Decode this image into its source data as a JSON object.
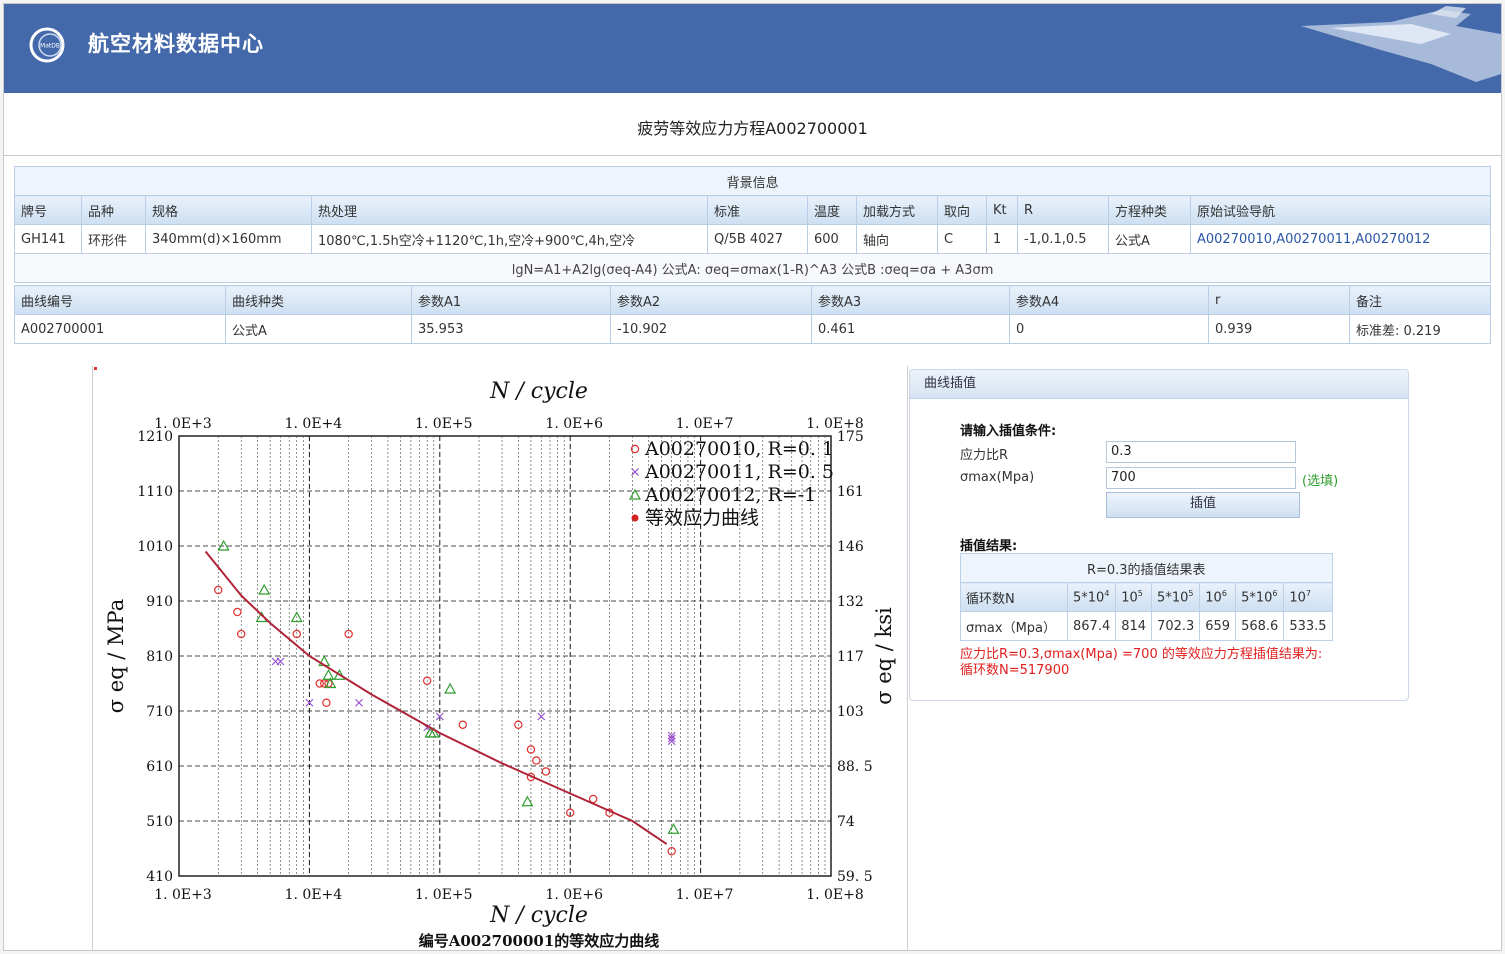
{
  "header": {
    "app_title": "航空材料数据中心",
    "logo_text": "MatDB"
  },
  "page_title": "疲劳等效应力方程A002700001",
  "background": {
    "caption": "背景信息",
    "headers": [
      "牌号",
      "品种",
      "规格",
      "热处理",
      "标准",
      "温度",
      "加载方式",
      "取向",
      "Kt",
      "R",
      "方程种类",
      "原始试验导航"
    ],
    "row": [
      "GH141",
      "环形件",
      "340mm(d)×160mm",
      "1080℃,1.5h空冷+1120℃,1h,空冷+900℃,4h,空冷",
      "Q/5B 4027",
      "600",
      "轴向",
      "C",
      "1",
      "-1,0.1,0.5",
      "公式A",
      "A00270010,A00270011,A00270012"
    ]
  },
  "formula": "lgN=A1+A2lg(σeq-A4) 公式A:  σeq=σmax(1-R)^A3 公式B :σeq=σa + A3σm",
  "curve": {
    "headers": [
      "曲线编号",
      "曲线种类",
      "参数A1",
      "参数A2",
      "参数A3",
      "参数A4",
      "r",
      "备注"
    ],
    "row": [
      "A002700001",
      "公式A",
      "35.953",
      "-10.902",
      "0.461",
      "0",
      "0.939",
      "标准差: 0.219"
    ]
  },
  "chart_data": {
    "type": "scatter",
    "title": "N / cycle",
    "xlabel": "N / cycle",
    "ylabel": "σ eq / MPa",
    "ylabel_right": "σ eq / ksi",
    "caption": "编号A002700001的等效应力曲线",
    "xscale": "log",
    "xlim": [
      1000,
      100000000
    ],
    "ylim": [
      410,
      1210
    ],
    "x_ticks": [
      "1. 0E+3",
      "1. 0E+4",
      "1. 0E+5",
      "1. 0E+6",
      "1. 0E+7",
      "1. 0E+8"
    ],
    "y_ticks": [
      "1210",
      "1110",
      "1010",
      "910",
      "810",
      "710",
      "610",
      "510",
      "410"
    ],
    "y_ticks_right": [
      "175",
      "161",
      "146",
      "132",
      "117",
      "103",
      "88. 5",
      "74",
      "59. 5"
    ],
    "grid": true,
    "legend_position": "top-right",
    "series": [
      {
        "name": "A00270010, R=0. 1",
        "marker": "circle",
        "color": "#e03030",
        "points": [
          [
            2000,
            930
          ],
          [
            2800,
            890
          ],
          [
            3000,
            850
          ],
          [
            8000,
            850
          ],
          [
            20000,
            850
          ],
          [
            12000,
            760
          ],
          [
            13000,
            760
          ],
          [
            14000,
            760
          ],
          [
            13500,
            725
          ],
          [
            80000,
            765
          ],
          [
            150000,
            685
          ],
          [
            400000,
            685
          ],
          [
            500000,
            640
          ],
          [
            550000,
            620
          ],
          [
            650000,
            600
          ],
          [
            500000,
            590
          ],
          [
            1000000,
            525
          ],
          [
            1500000,
            550
          ],
          [
            2000000,
            525
          ],
          [
            6000000,
            455
          ]
        ]
      },
      {
        "name": "A00270011, R=0. 5",
        "marker": "x",
        "color": "#9b4fd0",
        "points": [
          [
            5500,
            800
          ],
          [
            6000,
            800
          ],
          [
            10000,
            725
          ],
          [
            24000,
            725
          ],
          [
            80000,
            680
          ],
          [
            100000,
            700
          ],
          [
            600000,
            700
          ],
          [
            6000000,
            665
          ],
          [
            6000000,
            660
          ],
          [
            6000000,
            655
          ]
        ]
      },
      {
        "name": "A00270012, R=-1",
        "marker": "triangle",
        "color": "#2f9e2f",
        "points": [
          [
            2200,
            1010
          ],
          [
            4500,
            930
          ],
          [
            4300,
            880
          ],
          [
            8000,
            880
          ],
          [
            13000,
            800
          ],
          [
            14000,
            775
          ],
          [
            14500,
            760
          ],
          [
            17000,
            775
          ],
          [
            85000,
            670
          ],
          [
            90000,
            670
          ],
          [
            120000,
            750
          ],
          [
            470000,
            545
          ],
          [
            6200000,
            495
          ]
        ]
      },
      {
        "name": "等效应力曲线",
        "marker": "line",
        "color": "#b0243a",
        "points": [
          [
            1600,
            1000
          ],
          [
            3000,
            920
          ],
          [
            5000,
            870
          ],
          [
            10000,
            810
          ],
          [
            30000,
            740
          ],
          [
            100000,
            670
          ],
          [
            300000,
            615
          ],
          [
            1000000,
            560
          ],
          [
            3000000,
            510
          ],
          [
            5500000,
            468
          ]
        ]
      }
    ]
  },
  "interp": {
    "panel_title": "曲线插值",
    "input_title": "请输入插值条件:",
    "r_label": "应力比R",
    "r_value": "0.3",
    "smax_label": "σmax(Mpa)",
    "smax_value": "700",
    "optional": "(选填)",
    "button": "插值",
    "result_title": "插值结果:",
    "table_caption": "R=0.3的插值结果表",
    "cycle_label": "循环数N",
    "cycles": [
      [
        "5*10",
        "4"
      ],
      [
        "10",
        "5"
      ],
      [
        "5*10",
        "5"
      ],
      [
        "10",
        "6"
      ],
      [
        "5*10",
        "6"
      ],
      [
        "10",
        "7"
      ]
    ],
    "smax_row_label": "σmax（Mpa）",
    "smax_values": [
      "867.4",
      "814",
      "702.3",
      "659",
      "568.6",
      "533.5"
    ],
    "result_line1": "应力比R=0.3,σmax(Mpa) =700 的等效应力方程插值结果为:",
    "result_line2": "循环数N=517900"
  }
}
